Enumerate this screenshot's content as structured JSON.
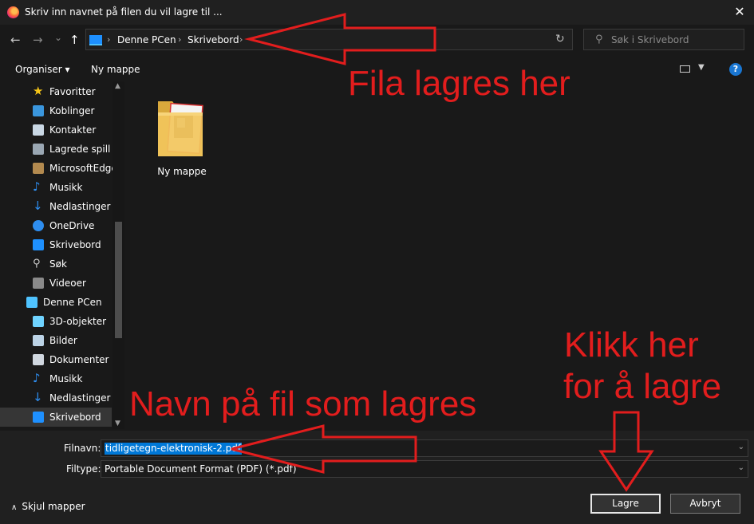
{
  "window": {
    "title": "Skriv inn navnet på filen du vil lagre til ...",
    "close_glyph": "✕"
  },
  "nav": {
    "back_glyph": "←",
    "forward_glyph": "→",
    "recent_glyph": "⌄",
    "up_glyph": "↑",
    "breadcrumb": [
      "Denne PCen",
      "Skrivebord"
    ],
    "breadcrumb_sep": "›",
    "refresh_glyph": "↻"
  },
  "search": {
    "placeholder": "Søk i Skrivebord",
    "icon": "search-icon"
  },
  "toolbar": {
    "organize_label": "Organiser ▾",
    "new_folder_label": "Ny mappe",
    "help_label": "?"
  },
  "sidebar": {
    "items": [
      {
        "label": "Favoritter",
        "icon": "star-icon"
      },
      {
        "label": "Koblinger",
        "icon": "link-icon"
      },
      {
        "label": "Kontakter",
        "icon": "contacts-icon"
      },
      {
        "label": "Lagrede spill",
        "icon": "saved-games-icon"
      },
      {
        "label": "MicrosoftEdge",
        "icon": "folder-icon"
      },
      {
        "label": "Musikk",
        "icon": "music-icon"
      },
      {
        "label": "Nedlastinger",
        "icon": "download-icon"
      },
      {
        "label": "OneDrive",
        "icon": "cloud-icon"
      },
      {
        "label": "Skrivebord",
        "icon": "desktop-icon"
      },
      {
        "label": "Søk",
        "icon": "search-icon"
      },
      {
        "label": "Videoer",
        "icon": "video-icon"
      },
      {
        "label": "Denne PCen",
        "icon": "computer-icon"
      },
      {
        "label": "3D-objekter",
        "icon": "cube-icon"
      },
      {
        "label": "Bilder",
        "icon": "pictures-icon"
      },
      {
        "label": "Dokumenter",
        "icon": "document-icon"
      },
      {
        "label": "Musikk",
        "icon": "music-icon"
      },
      {
        "label": "Nedlastinger",
        "icon": "download-icon"
      },
      {
        "label": "Skrivebord",
        "icon": "desktop-icon",
        "selected": true
      }
    ]
  },
  "main": {
    "items": [
      {
        "label": "Ny mappe",
        "icon": "folder-icon"
      }
    ]
  },
  "form": {
    "filename_label": "Filnavn:",
    "filename_value": "tidligetegn-elektronisk-2.pdf",
    "filetype_label": "Filtype:",
    "filetype_value": "Portable Document Format (PDF) (*.pdf)"
  },
  "footer": {
    "hide_folders_label": "Skjul mapper",
    "save_label": "Lagre",
    "cancel_label": "Avbryt"
  },
  "annotations": {
    "folder_hint": "Fila lagres her",
    "filename_hint": "Navn på fil som lagres",
    "save_hint_line1": "Klikk her",
    "save_hint_line2": "for å lagre"
  },
  "colors": {
    "background": "#191919",
    "annotation": "#e21d1d",
    "selection": "#0078d7",
    "selected_nav": "#363636"
  }
}
